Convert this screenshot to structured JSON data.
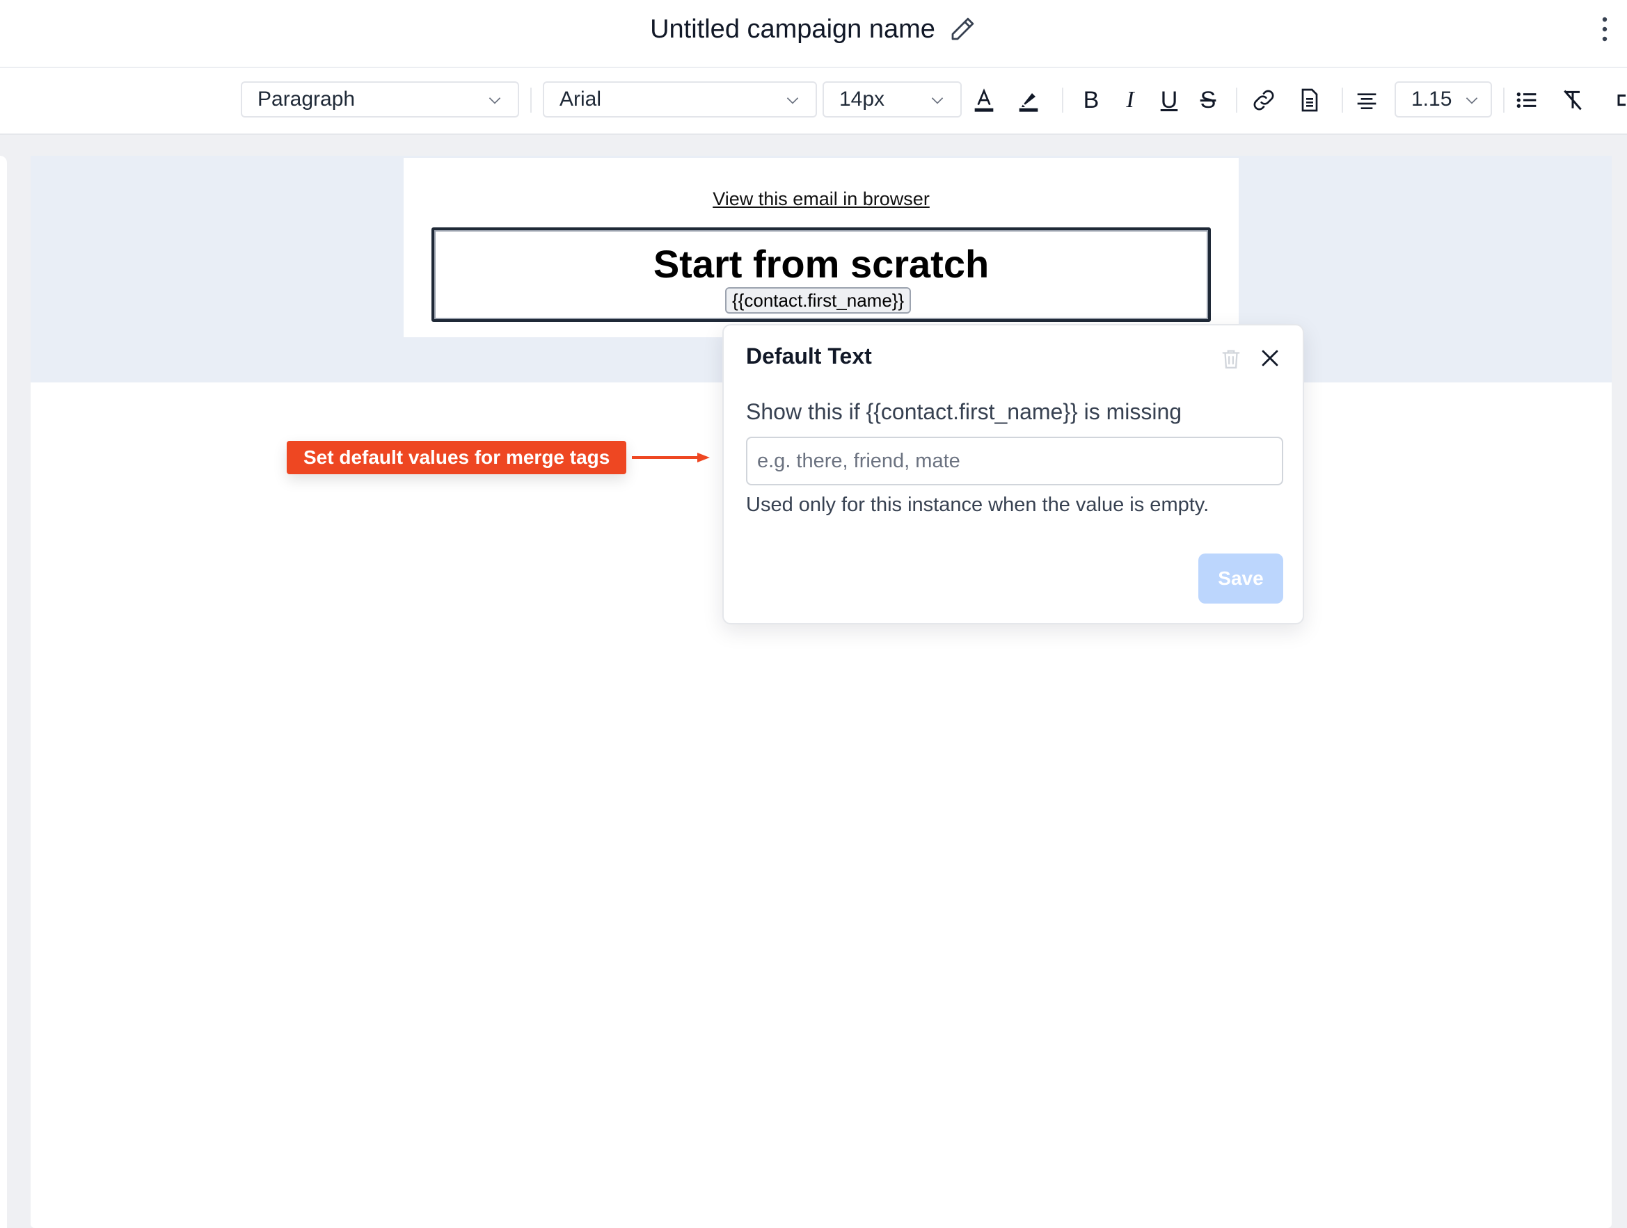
{
  "header": {
    "campaign_title": "Untitled campaign name"
  },
  "toolbar": {
    "block_type": "Paragraph",
    "font_family": "Arial",
    "font_size": "14px",
    "line_height": "1.15",
    "bold_label": "B",
    "italic_label": "I",
    "underline_label": "U",
    "strike_label": "S"
  },
  "email": {
    "view_in_browser": "View this email in browser",
    "heading": "Start from scratch",
    "merge_tag": "{{contact.first_name}}"
  },
  "popover": {
    "title": "Default Text",
    "prompt": "Show this if {{contact.first_name}} is missing",
    "input_placeholder": "e.g. there, friend, mate",
    "input_value": "",
    "help_text": "Used only for this instance when the value is empty.",
    "save_label": "Save"
  },
  "callout": {
    "text": "Set default values for merge tags"
  },
  "colors": {
    "accent_callout": "#ee4722",
    "save_disabled": "#bcd6fd",
    "canvas_band": "#e9eef6"
  },
  "icons": {
    "edit": "pencil-icon",
    "more": "kebab-menu-icon",
    "delete": "trash-icon",
    "close": "close-icon"
  }
}
